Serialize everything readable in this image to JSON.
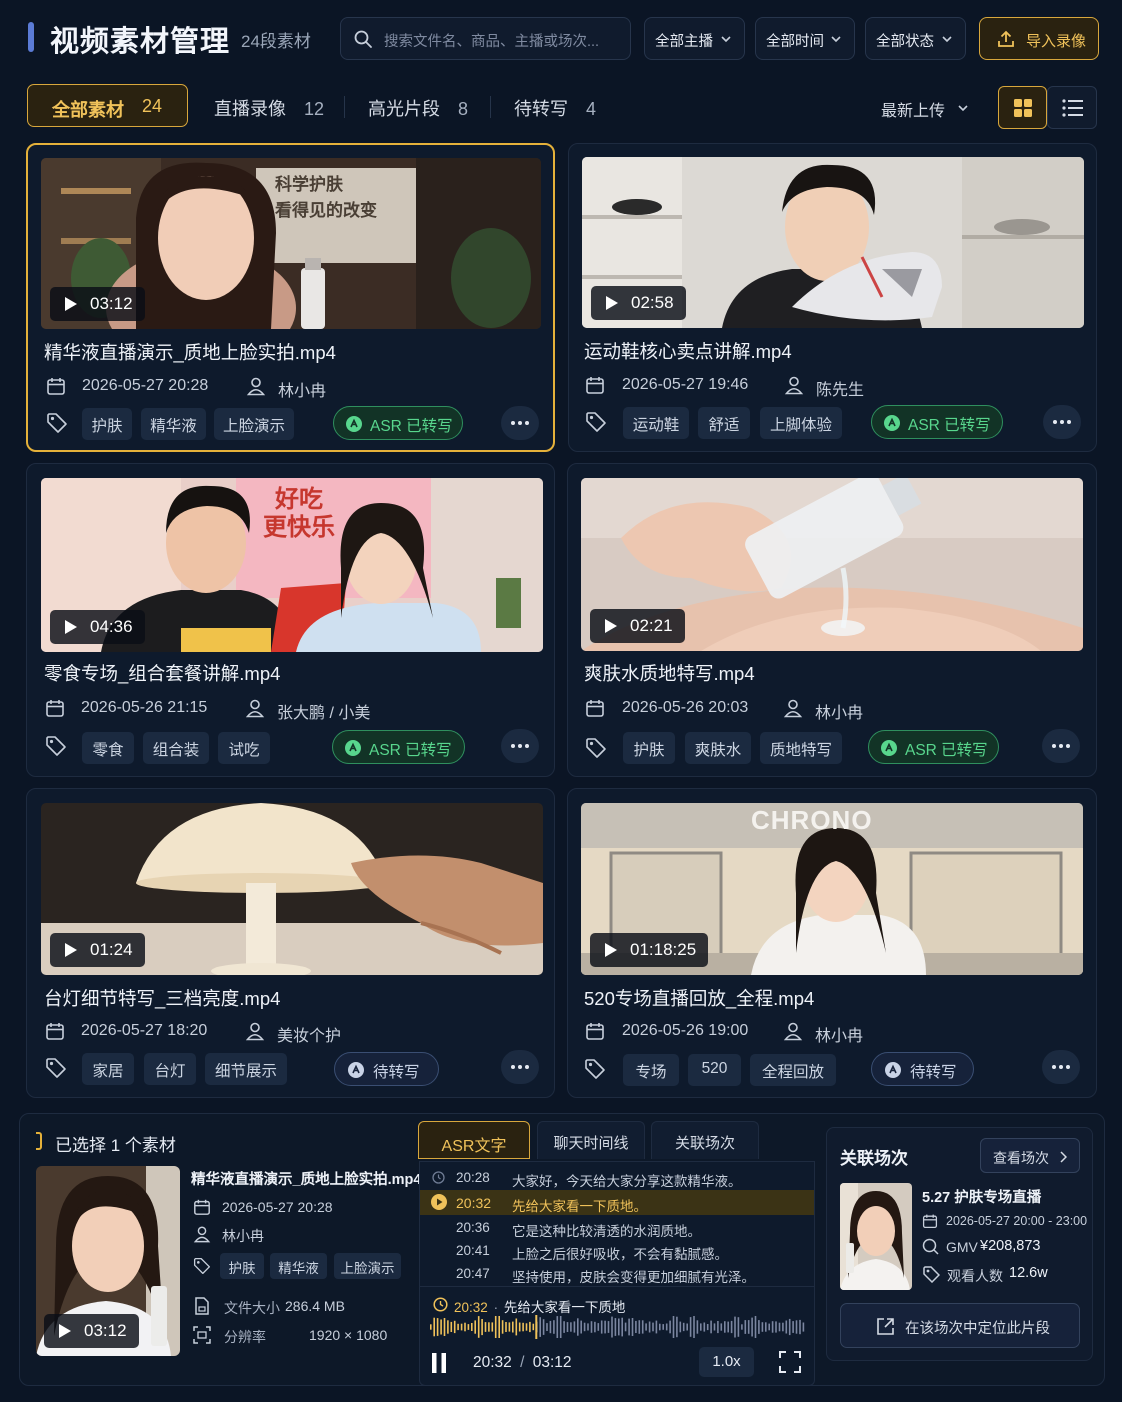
{
  "header": {
    "title": "视频素材管理",
    "subtitle": "24段素材",
    "search_placeholder": "搜索文件名、商品、主播或场次...",
    "filters": [
      "全部主播",
      "全部时间",
      "全部状态"
    ],
    "import_label": "导入录像"
  },
  "tabs": [
    {
      "label": "全部素材",
      "count": "24",
      "active": true
    },
    {
      "label": "直播录像",
      "count": "12"
    },
    {
      "label": "高光片段",
      "count": "8"
    },
    {
      "label": "待转写",
      "count": "4"
    }
  ],
  "sort_label": "最新上传",
  "cards": [
    {
      "duration": "03:12",
      "filename": "精华液直播演示_质地上脸实拍.mp4",
      "date": "2026-05-27 20:28",
      "host": "林小冉",
      "tags": [
        "护肤",
        "精华液",
        "上脸演示"
      ],
      "status": "ASR 已转写",
      "selected": true
    },
    {
      "duration": "02:58",
      "filename": "运动鞋核心卖点讲解.mp4",
      "date": "2026-05-27 19:46",
      "host": "陈先生",
      "tags": [
        "运动鞋",
        "舒适",
        "上脚体验"
      ],
      "status": "ASR 已转写"
    },
    {
      "duration": "04:36",
      "filename": "零食专场_组合套餐讲解.mp4",
      "date": "2026-05-26 21:15",
      "host": "张大鹏 / 小美",
      "tags": [
        "零食",
        "组合装",
        "试吃"
      ],
      "status": "ASR 已转写"
    },
    {
      "duration": "02:21",
      "filename": "爽肤水质地特写.mp4",
      "date": "2026-05-26 20:03",
      "host": "林小冉",
      "tags": [
        "护肤",
        "爽肤水",
        "质地特写"
      ],
      "status": "ASR 已转写"
    },
    {
      "duration": "01:24",
      "filename": "台灯细节特写_三档亮度.mp4",
      "date": "2026-05-27 18:20",
      "host": "美妆个护",
      "tags": [
        "家居",
        "台灯",
        "细节展示"
      ],
      "status": "待转写"
    },
    {
      "duration": "01:18:25",
      "filename": "520专场直播回放_全程.mp4",
      "date": "2026-05-26 19:00",
      "host": "林小冉",
      "tags": [
        "专场",
        "520",
        "全程回放"
      ],
      "status": "待转写"
    }
  ],
  "thumb_text": {
    "card1_sign": [
      "科学护肤",
      "看得见的改变"
    ],
    "card3_sign": [
      "好吃",
      "更快乐"
    ],
    "card6_store": "CHRONO"
  },
  "detail": {
    "selected_text": "已选择 1 个素材",
    "duration": "03:12",
    "filename": "精华液直播演示_质地上脸实拍.mp4",
    "date": "2026-05-27 20:28",
    "host": "林小冉",
    "tags": [
      "护肤",
      "精华液",
      "上脸演示"
    ],
    "size_label": "文件大小",
    "size": "286.4 MB",
    "res_label": "分辨率",
    "resolution": "1920 × 1080"
  },
  "asr": {
    "tabs": [
      "ASR文字",
      "聊天时间线",
      "关联场次"
    ],
    "lines": [
      {
        "time": "20:28",
        "text": "大家好，今天给大家分享这款精华液。"
      },
      {
        "time": "20:32",
        "text": "先给大家看一下质地。",
        "active": true
      },
      {
        "time": "20:36",
        "text": "它是这种比较清透的水润质地。"
      },
      {
        "time": "20:41",
        "text": "上脸之后很好吸收，不会有黏腻感。"
      },
      {
        "time": "20:47",
        "text": "坚持使用，皮肤会变得更加细腻有光泽。"
      }
    ],
    "now_time": "20:32",
    "now_text": "先给大家看一下质地",
    "now_sep": "·",
    "current": "20:32",
    "time_sep": "/",
    "total": "03:12",
    "speed": "1.0x",
    "progress": 0.28
  },
  "related": {
    "title": "关联场次",
    "view_label": "查看场次",
    "session_name": "5.27 护肤专场直播",
    "session_time": "2026-05-27 20:00 - 23:00",
    "gmv_label": "GMV",
    "gmv": "¥208,873",
    "viewers_label": "观看人数",
    "viewers": "12.6w",
    "locate_label": "在该场次中定位此片段"
  },
  "colors": {
    "accent": "#e5b13a",
    "asr_green": "#58d68d",
    "background": "#0b1525"
  }
}
